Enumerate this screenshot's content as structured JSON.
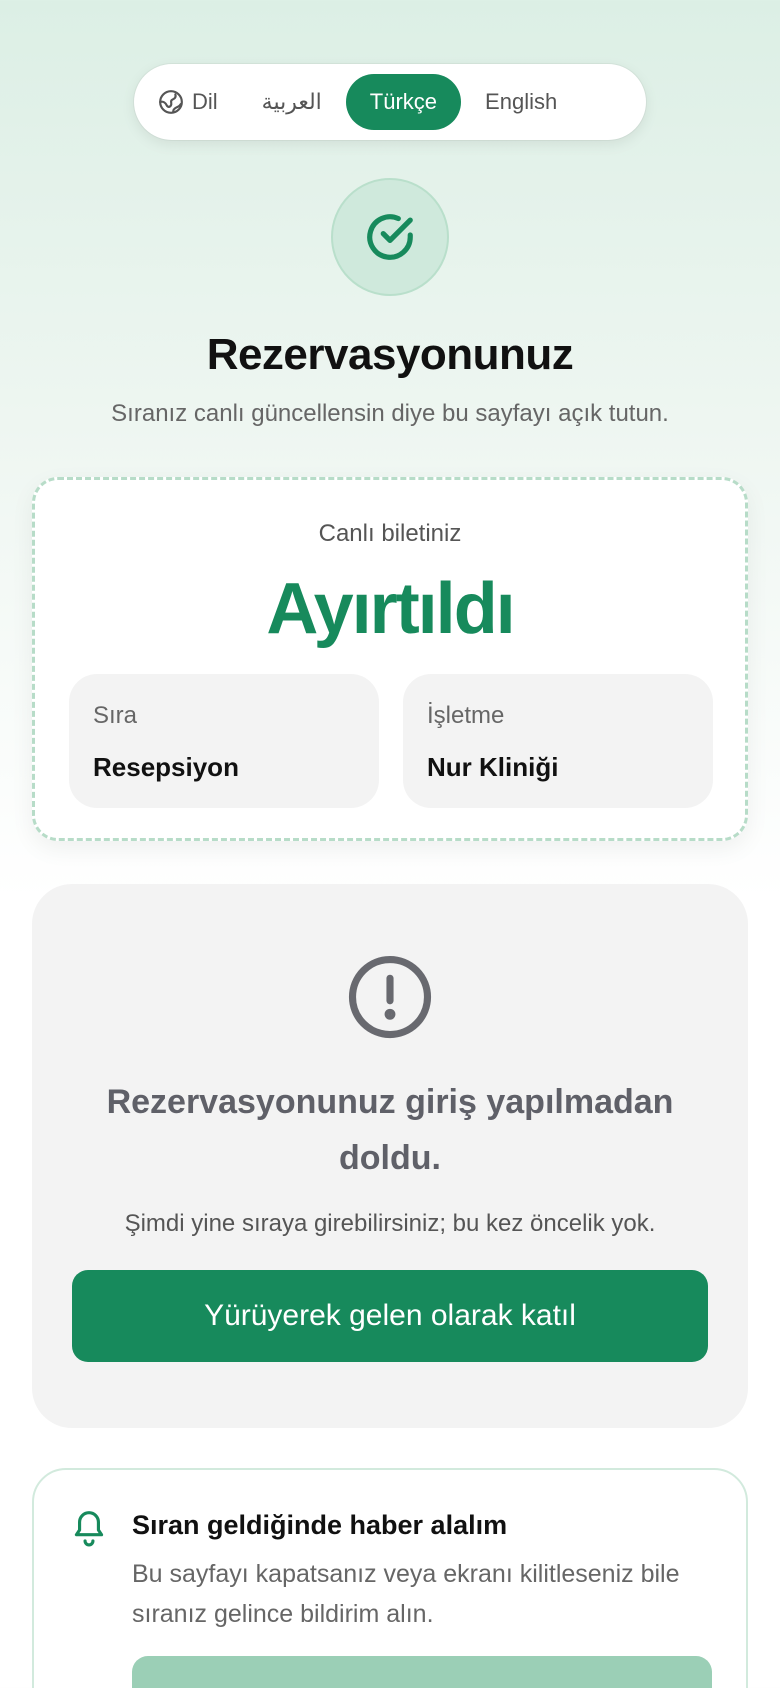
{
  "language_switcher": {
    "globe_icon": "globe-icon",
    "label": "Dil",
    "options": [
      "العربية",
      "Türkçe",
      "English"
    ],
    "selected": "Türkçe"
  },
  "header": {
    "icon": "check-circle-icon",
    "title": "Rezervasyonunuz",
    "subtitle": "Sıranız canlı güncellensin diye bu sayfayı açık tutun."
  },
  "ticket": {
    "label": "Canlı biletiniz",
    "status": "Ayırtıldı",
    "queue_label": "Sıra",
    "queue_value": "Resepsiyon",
    "business_label": "İşletme",
    "business_value": "Nur Kliniği"
  },
  "expired_notice": {
    "icon": "exclamation-circle-icon",
    "title": "Rezervasyonunuz giriş yapılmadan doldu.",
    "text": "Şimdi yine sıraya girebilirsiniz; bu kez öncelik yok.",
    "button_label": "Yürüyerek gelen olarak katıl"
  },
  "notify_card": {
    "icon": "bell-icon",
    "title": "Sıran geldiğinde haber alalım",
    "text": "Bu sayfayı kapatsanız veya ekranı kilitleseniz bile sıranız gelince bildirim alın."
  },
  "colors": {
    "accent": "#178a5c",
    "accent_light": "#cfe9dc",
    "muted_text": "#666666",
    "card_gray": "#f3f3f3"
  }
}
